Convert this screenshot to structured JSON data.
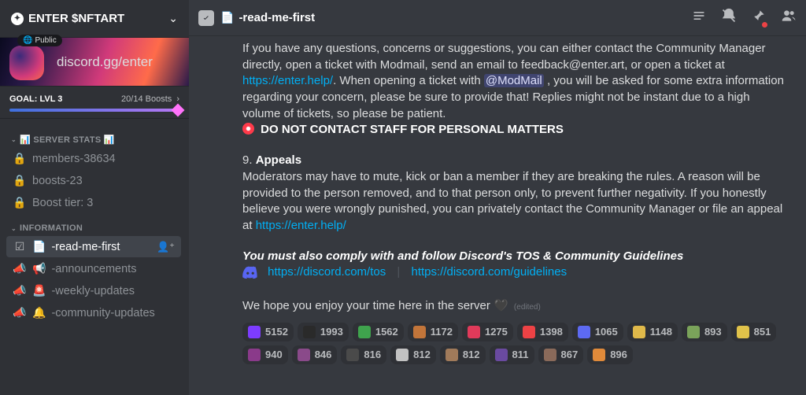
{
  "server": {
    "name": "ENTER $NFTART",
    "public_label": "Public",
    "invite_url": "discord.gg/enter"
  },
  "goal": {
    "label": "GOAL: LVL 3",
    "boosts": "20/14 Boosts"
  },
  "categories": [
    {
      "name": "📊 SERVER STATS 📊",
      "channels": [
        {
          "icon": "lock",
          "prefix": "",
          "label": "members-38634",
          "selected": false
        },
        {
          "icon": "lock",
          "prefix": "",
          "label": "boosts-23",
          "selected": false
        },
        {
          "icon": "lock",
          "prefix": "",
          "label": "Boost tier: 3",
          "selected": false
        }
      ]
    },
    {
      "name": "INFORMATION",
      "channels": [
        {
          "icon": "rules",
          "prefix": "📄",
          "label": "-read-me-first",
          "selected": true
        },
        {
          "icon": "announce",
          "prefix": "📢",
          "label": "-announcements",
          "selected": false
        },
        {
          "icon": "announce",
          "prefix": "🚨",
          "label": "-weekly-updates",
          "selected": false
        },
        {
          "icon": "announce",
          "prefix": "🔔",
          "label": "-community-updates",
          "selected": false
        }
      ]
    }
  ],
  "topbar": {
    "channel_prefix": "📄",
    "channel_name": "-read-me-first"
  },
  "message": {
    "contact_p1": "If you have any questions, concerns or suggestions, you can either contact the Community Manager directly, open a ticket with Modmail, send an email to feedback@enter.art, or open a ticket at ",
    "contact_link1": "https://enter.help/",
    "contact_p2": ". When opening a ticket with ",
    "modmail_mention": "@ModMail",
    "contact_p3": " , you will be asked for some extra information regarding your concern, please be sure to provide that! Replies might not be instant due to a high volume of tickets, so please be patient.",
    "no_contact": "DO NOT CONTACT STAFF FOR PERSONAL MATTERS",
    "section9_num": "9. ",
    "section9_title": "Appeals",
    "appeals_p1": "Moderators may have to mute, kick or ban a member if they are breaking the rules. A reason will be provided to the person removed, and to that person only, to prevent further negativity. If you honestly believe you were wrongly punished, you can privately contact the Community Manager or file an appeal at ",
    "appeals_link": "https://enter.help/",
    "tos_line": "You must also comply with and follow Discord's TOS & Community Guidelines",
    "tos_link": "https://discord.com/tos",
    "guidelines_link": "https://discord.com/guidelines",
    "closing": "We hope you enjoy your time here in the server ",
    "closing_emoji": "🖤",
    "edited_label": "(edited)"
  },
  "reactions": [
    {
      "emoji_bg": "#7d3cff",
      "count": "5152"
    },
    {
      "emoji_bg": "#2a2a2a",
      "count": "1993"
    },
    {
      "emoji_bg": "#3fa34d",
      "count": "1562"
    },
    {
      "emoji_bg": "#c2753a",
      "count": "1172"
    },
    {
      "emoji_bg": "#e03a5a",
      "count": "1275"
    },
    {
      "emoji_bg": "#ed4245",
      "count": "1398"
    },
    {
      "emoji_bg": "#5d6af2",
      "count": "1065"
    },
    {
      "emoji_bg": "#e0b94a",
      "count": "1148"
    },
    {
      "emoji_bg": "#7aa35a",
      "count": "893"
    },
    {
      "emoji_bg": "#e0c24a",
      "count": "851"
    },
    {
      "emoji_bg": "#8a3a8a",
      "count": "940"
    },
    {
      "emoji_bg": "#8a4a8a",
      "count": "846"
    },
    {
      "emoji_bg": "#4a4a4a",
      "count": "816"
    },
    {
      "emoji_bg": "#c2c2c2",
      "count": "812"
    },
    {
      "emoji_bg": "#a07a5a",
      "count": "812"
    },
    {
      "emoji_bg": "#6a4aa0",
      "count": "811"
    },
    {
      "emoji_bg": "#8a6a5a",
      "count": "867"
    },
    {
      "emoji_bg": "#e08a3a",
      "count": "896"
    }
  ]
}
